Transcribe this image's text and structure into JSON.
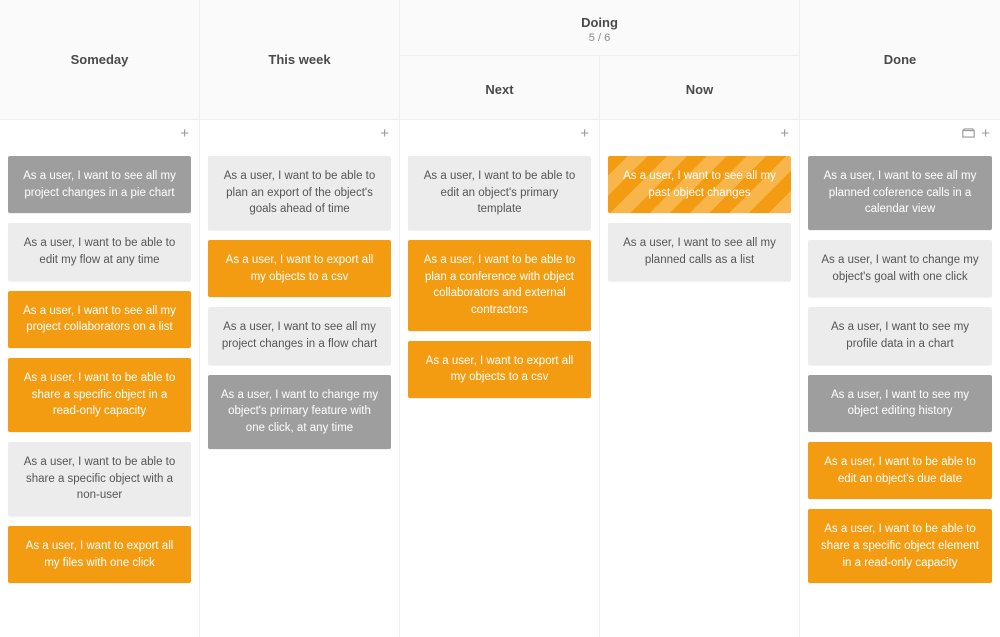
{
  "columns": {
    "someday": {
      "title": "Someday",
      "cards": [
        {
          "text": "As a user, I want to see all my project changes in a pie chart",
          "style": "grey"
        },
        {
          "text": "As a user, I want to be able to edit my flow at any time",
          "style": "light"
        },
        {
          "text": "As a user, I want to see all my project collaborators on a list",
          "style": "orange"
        },
        {
          "text": "As a user, I want to be able to share a specific object in a read-only capacity",
          "style": "orange"
        },
        {
          "text": "As a user, I want to be able to share a specific object with a non-user",
          "style": "light"
        },
        {
          "text": "As a user, I want to export all my files with one click",
          "style": "orange"
        }
      ]
    },
    "thisweek": {
      "title": "This week",
      "cards": [
        {
          "text": "As a user, I want to be able to plan an export of the object's goals ahead of time",
          "style": "light"
        },
        {
          "text": "As a user, I want to export all my objects to a csv",
          "style": "orange"
        },
        {
          "text": "As a user, I want to see all my project changes in a flow chart",
          "style": "light"
        },
        {
          "text": "As a user, I want to change my object's primary feature with one click, at any time",
          "style": "grey"
        }
      ]
    },
    "doing": {
      "title": "Doing",
      "subtitle": "5 / 6",
      "sub": {
        "next": {
          "title": "Next",
          "cards": [
            {
              "text": "As a user, I want to be able to edit an object's primary template",
              "style": "light"
            },
            {
              "text": "As a user, I want to be able to plan a conference with object collaborators and external contractors",
              "style": "orange"
            },
            {
              "text": "As a user, I want to export all my objects to a csv",
              "style": "orange"
            }
          ]
        },
        "now": {
          "title": "Now",
          "cards": [
            {
              "text": "As a user, I want to see all my past object changes",
              "style": "orange-striped"
            },
            {
              "text": "As a user, I want to see all my planned calls as a list",
              "style": "light"
            }
          ]
        }
      }
    },
    "done": {
      "title": "Done",
      "cards": [
        {
          "text": "As a user, I want to see all my planned coference calls in a calendar view",
          "style": "grey"
        },
        {
          "text": "As a user, I want to change my object's goal with one click",
          "style": "light"
        },
        {
          "text": "As a user, I want to see my profile data in a chart",
          "style": "light"
        },
        {
          "text": "As a user, I want to see my object editing history",
          "style": "grey"
        },
        {
          "text": "As a user, I want to be able to edit an object's due date",
          "style": "orange"
        },
        {
          "text": "As a user, I want to be able to share a specific object element in a read-only capacity",
          "style": "orange"
        }
      ]
    }
  },
  "glyphs": {
    "plus": "+"
  }
}
